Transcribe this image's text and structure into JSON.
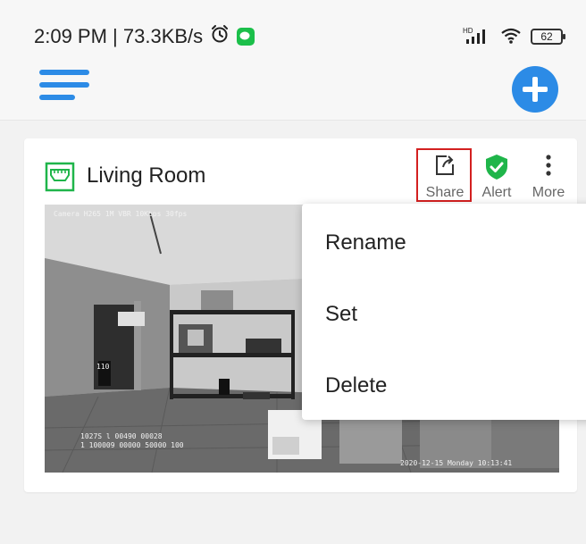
{
  "status_bar": {
    "time": "2:09 PM | 73.3KB/s",
    "battery": "62",
    "network_badge": "HD"
  },
  "device_card": {
    "name": "Living Room",
    "actions": {
      "share_label": "Share",
      "alert_label": "Alert",
      "more_label": "More"
    },
    "video": {
      "osd_top": "Camera  H265  1M  VBR  10Kbps  30fps",
      "osd_bottom_line1": "1027S  l  00490  00028",
      "osd_bottom_line2": "1 100009  00000  50000  100",
      "osd_timestamp": "2020-12-15  Monday  10:13:41",
      "box_label": "110"
    }
  },
  "more_menu": {
    "items": [
      "Rename",
      "Set",
      "Delete"
    ]
  },
  "colors": {
    "accent": "#2c8be6",
    "green": "#1fb54a",
    "highlight": "#d32020"
  }
}
